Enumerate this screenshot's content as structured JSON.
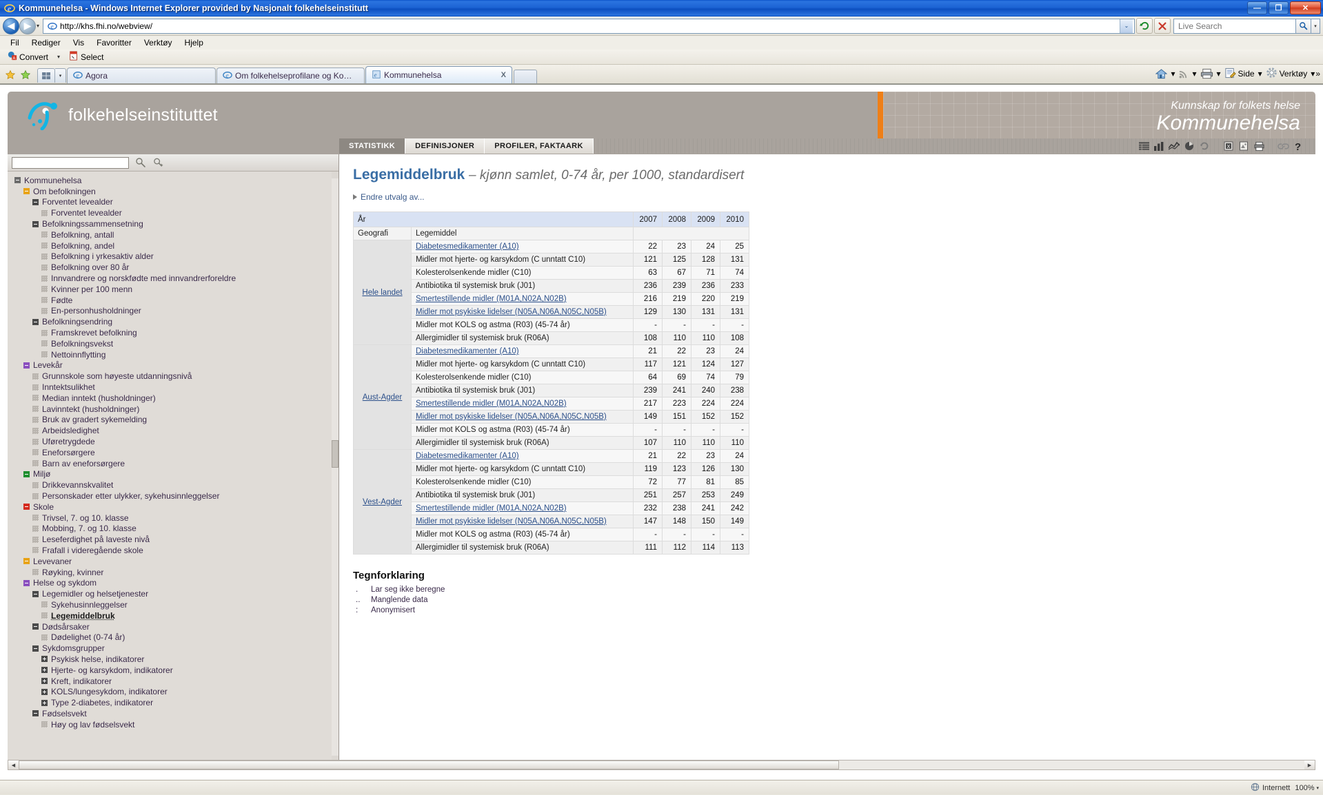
{
  "window": {
    "title": "Kommunehelsa - Windows Internet Explorer provided by Nasjonalt folkehelseinstitutt",
    "minimize": "—",
    "maximize": "❐",
    "close": "✕"
  },
  "address": {
    "url": "http://khs.fhi.no/webview/",
    "dropdown_caret": "⌄",
    "refresh_icon": "refresh-icon",
    "stop_icon": "stop-icon",
    "search_placeholder": "Live Search"
  },
  "menu": {
    "items": [
      "Fil",
      "Rediger",
      "Vis",
      "Favoritter",
      "Verktøy",
      "Hjelp"
    ]
  },
  "acrobat_toolbar": {
    "convert_label": "Convert",
    "select_label": "Select",
    "dropdown_caret": "▾"
  },
  "tabs": {
    "items": [
      {
        "label": "Agora",
        "active": false
      },
      {
        "label": "Om folkehelseprofilane og Ko…",
        "active": false
      },
      {
        "label": "Kommunehelsa",
        "active": true,
        "close": "X"
      }
    ]
  },
  "browser_tools": {
    "home": "Hjem",
    "feeds": "Feeds",
    "print": "Skriv ut",
    "page_label": "Side",
    "tools_label": "Verktøy",
    "overflow": "»",
    "caret": "▾"
  },
  "site_header": {
    "logo_text": "folkehelseinstituttet",
    "tagline": "Kunnskap for folkets helse",
    "site_name": "Kommunehelsa",
    "accent_color": "#ee7f18",
    "header_bg": "#a9a39d"
  },
  "nav": {
    "tabs": [
      {
        "label": "STATISTIKK",
        "active": true
      },
      {
        "label": "DEFINISJONER",
        "active": false
      },
      {
        "label": "PROFILER, FAKTAARK",
        "active": false
      }
    ],
    "icons": [
      "table-view-icon",
      "bar-chart-icon",
      "line-chart-icon",
      "pie-chart-icon",
      "refresh-icon",
      "excel-export-icon",
      "pdf-export-icon",
      "print-icon",
      "link-icon",
      "help-icon"
    ]
  },
  "sidebar": {
    "search_value": "",
    "search_icon": "search-icon",
    "search_advanced_icon": "advanced-search-icon",
    "tree": [
      {
        "label": "Kommunehelsa",
        "level": 0,
        "type": "box",
        "color": "#6b6b6b"
      },
      {
        "label": "Om befolkningen",
        "level": 1,
        "type": "box",
        "color": "#e8a317"
      },
      {
        "label": "Forventet levealder",
        "level": 2,
        "type": "box",
        "color": "#4a4a4a"
      },
      {
        "label": "Forventet levealder",
        "level": 3,
        "type": "leaf"
      },
      {
        "label": "Befolkningssammensetning",
        "level": 2,
        "type": "box",
        "color": "#4a4a4a"
      },
      {
        "label": "Befolkning, antall",
        "level": 3,
        "type": "leaf"
      },
      {
        "label": "Befolkning, andel",
        "level": 3,
        "type": "leaf"
      },
      {
        "label": "Befolkning i yrkesaktiv alder",
        "level": 3,
        "type": "leaf"
      },
      {
        "label": "Befolkning over 80 år",
        "level": 3,
        "type": "leaf"
      },
      {
        "label": "Innvandrere og norskfødte med innvandrerforeldre",
        "level": 3,
        "type": "leaf"
      },
      {
        "label": "Kvinner per 100 menn",
        "level": 3,
        "type": "leaf"
      },
      {
        "label": "Fødte",
        "level": 3,
        "type": "leaf"
      },
      {
        "label": "En-personhusholdninger",
        "level": 3,
        "type": "leaf"
      },
      {
        "label": "Befolkningsendring",
        "level": 2,
        "type": "box",
        "color": "#4a4a4a"
      },
      {
        "label": "Framskrevet befolkning",
        "level": 3,
        "type": "leaf"
      },
      {
        "label": "Befolkningsvekst",
        "level": 3,
        "type": "leaf"
      },
      {
        "label": "Nettoinnflytting",
        "level": 3,
        "type": "leaf"
      },
      {
        "label": "Levekår",
        "level": 1,
        "type": "box",
        "color": "#8a4fbe"
      },
      {
        "label": "Grunnskole som høyeste utdanningsnivå",
        "level": 2,
        "type": "leaf"
      },
      {
        "label": "Inntektsulikhet",
        "level": 2,
        "type": "leaf"
      },
      {
        "label": "Median inntekt (husholdninger)",
        "level": 2,
        "type": "leaf"
      },
      {
        "label": "Lavinntekt (husholdninger)",
        "level": 2,
        "type": "leaf"
      },
      {
        "label": "Bruk av gradert sykemelding",
        "level": 2,
        "type": "leaf"
      },
      {
        "label": "Arbeidsledighet",
        "level": 2,
        "type": "leaf"
      },
      {
        "label": "Uføretrygdede",
        "level": 2,
        "type": "leaf"
      },
      {
        "label": "Eneforsørgere",
        "level": 2,
        "type": "leaf"
      },
      {
        "label": "Barn av eneforsørgere",
        "level": 2,
        "type": "leaf"
      },
      {
        "label": "Miljø",
        "level": 1,
        "type": "box",
        "color": "#1e8e2e"
      },
      {
        "label": "Drikkevannskvalitet",
        "level": 2,
        "type": "leaf"
      },
      {
        "label": "Personskader etter ulykker, sykehusinnleggelser",
        "level": 2,
        "type": "leaf"
      },
      {
        "label": "Skole",
        "level": 1,
        "type": "box",
        "color": "#d42a1e"
      },
      {
        "label": "Trivsel, 7. og 10. klasse",
        "level": 2,
        "type": "leaf"
      },
      {
        "label": "Mobbing, 7. og 10. klasse",
        "level": 2,
        "type": "leaf"
      },
      {
        "label": "Leseferdighet på laveste nivå",
        "level": 2,
        "type": "leaf"
      },
      {
        "label": "Frafall i videregående skole",
        "level": 2,
        "type": "leaf"
      },
      {
        "label": "Levevaner",
        "level": 1,
        "type": "box",
        "color": "#e8a317"
      },
      {
        "label": "Røyking, kvinner",
        "level": 2,
        "type": "leaf"
      },
      {
        "label": "Helse og sykdom",
        "level": 1,
        "type": "box",
        "color": "#8a4fbe"
      },
      {
        "label": "Legemidler og helsetjenester",
        "level": 2,
        "type": "box",
        "color": "#4a4a4a"
      },
      {
        "label": "Sykehusinnleggelser",
        "level": 3,
        "type": "leaf"
      },
      {
        "label": "Legemiddelbruk",
        "level": 3,
        "type": "leaf",
        "selected": true
      },
      {
        "label": "Dødsårsaker",
        "level": 2,
        "type": "box",
        "color": "#4a4a4a"
      },
      {
        "label": "Dødelighet (0-74 år)",
        "level": 3,
        "type": "leaf"
      },
      {
        "label": "Sykdomsgrupper",
        "level": 2,
        "type": "box",
        "color": "#4a4a4a"
      },
      {
        "label": "Psykisk helse, indikatorer",
        "level": 3,
        "type": "box",
        "plus": true,
        "color": "#4a4a4a"
      },
      {
        "label": "Hjerte- og karsykdom, indikatorer",
        "level": 3,
        "type": "box",
        "plus": true,
        "color": "#4a4a4a"
      },
      {
        "label": "Kreft, indikatorer",
        "level": 3,
        "type": "box",
        "plus": true,
        "color": "#4a4a4a"
      },
      {
        "label": "KOLS/lungesykdom, indikatorer",
        "level": 3,
        "type": "box",
        "plus": true,
        "color": "#4a4a4a"
      },
      {
        "label": "Type 2-diabetes, indikatorer",
        "level": 3,
        "type": "box",
        "plus": true,
        "color": "#4a4a4a"
      },
      {
        "label": "Fødselsvekt",
        "level": 2,
        "type": "box",
        "color": "#4a4a4a"
      },
      {
        "label": "Høy og lav fødselsvekt",
        "level": 3,
        "type": "leaf"
      }
    ]
  },
  "content": {
    "title": "Legemiddelbruk",
    "subtitle": "– kjønn samlet, 0-74 år, per 1000, standardisert",
    "change_selection": "Endre utvalg av...",
    "table": {
      "year_header": "År",
      "geo_header": "Geografi",
      "drug_header": "Legemiddel",
      "years": [
        "2007",
        "2008",
        "2009",
        "2010"
      ],
      "groups": [
        {
          "geography": "Hele landet",
          "rows": [
            {
              "drug": "Diabetesmedikamenter (A10)",
              "link": true,
              "values": [
                "22",
                "23",
                "24",
                "25"
              ]
            },
            {
              "drug": "Midler mot hjerte- og karsykdom (C unntatt C10)",
              "link": false,
              "values": [
                "121",
                "125",
                "128",
                "131"
              ]
            },
            {
              "drug": "Kolesterolsenkende midler (C10)",
              "link": false,
              "values": [
                "63",
                "67",
                "71",
                "74"
              ]
            },
            {
              "drug": "Antibiotika til systemisk bruk (J01)",
              "link": false,
              "values": [
                "236",
                "239",
                "236",
                "233"
              ]
            },
            {
              "drug": "Smertestillende midler (M01A,N02A,N02B)",
              "link": true,
              "values": [
                "216",
                "219",
                "220",
                "219"
              ]
            },
            {
              "drug": "Midler mot psykiske lidelser (N05A,N06A,N05C,N05B)",
              "link": true,
              "values": [
                "129",
                "130",
                "131",
                "131"
              ]
            },
            {
              "drug": "Midler mot KOLS og astma (R03) (45-74 år)",
              "link": false,
              "values": [
                "-",
                "-",
                "-",
                "-"
              ]
            },
            {
              "drug": "Allergimidler til systemisk bruk (R06A)",
              "link": false,
              "values": [
                "108",
                "110",
                "110",
                "108"
              ]
            }
          ]
        },
        {
          "geography": "Aust-Agder",
          "rows": [
            {
              "drug": "Diabetesmedikamenter (A10)",
              "link": true,
              "values": [
                "21",
                "22",
                "23",
                "24"
              ]
            },
            {
              "drug": "Midler mot hjerte- og karsykdom (C unntatt C10)",
              "link": false,
              "values": [
                "117",
                "121",
                "124",
                "127"
              ]
            },
            {
              "drug": "Kolesterolsenkende midler (C10)",
              "link": false,
              "values": [
                "64",
                "69",
                "74",
                "79"
              ]
            },
            {
              "drug": "Antibiotika til systemisk bruk (J01)",
              "link": false,
              "values": [
                "239",
                "241",
                "240",
                "238"
              ]
            },
            {
              "drug": "Smertestillende midler (M01A,N02A,N02B)",
              "link": true,
              "values": [
                "217",
                "223",
                "224",
                "224"
              ]
            },
            {
              "drug": "Midler mot psykiske lidelser (N05A,N06A,N05C,N05B)",
              "link": true,
              "values": [
                "149",
                "151",
                "152",
                "152"
              ]
            },
            {
              "drug": "Midler mot KOLS og astma (R03) (45-74 år)",
              "link": false,
              "values": [
                "-",
                "-",
                "-",
                "-"
              ]
            },
            {
              "drug": "Allergimidler til systemisk bruk (R06A)",
              "link": false,
              "values": [
                "107",
                "110",
                "110",
                "110"
              ]
            }
          ]
        },
        {
          "geography": "Vest-Agder",
          "rows": [
            {
              "drug": "Diabetesmedikamenter (A10)",
              "link": true,
              "values": [
                "21",
                "22",
                "23",
                "24"
              ]
            },
            {
              "drug": "Midler mot hjerte- og karsykdom (C unntatt C10)",
              "link": false,
              "values": [
                "119",
                "123",
                "126",
                "130"
              ]
            },
            {
              "drug": "Kolesterolsenkende midler (C10)",
              "link": false,
              "values": [
                "72",
                "77",
                "81",
                "85"
              ]
            },
            {
              "drug": "Antibiotika til systemisk bruk (J01)",
              "link": false,
              "values": [
                "251",
                "257",
                "253",
                "249"
              ]
            },
            {
              "drug": "Smertestillende midler (M01A,N02A,N02B)",
              "link": true,
              "values": [
                "232",
                "238",
                "241",
                "242"
              ]
            },
            {
              "drug": "Midler mot psykiske lidelser (N05A,N06A,N05C,N05B)",
              "link": true,
              "values": [
                "147",
                "148",
                "150",
                "149"
              ]
            },
            {
              "drug": "Midler mot KOLS og astma (R03) (45-74 år)",
              "link": false,
              "values": [
                "-",
                "-",
                "-",
                "-"
              ]
            },
            {
              "drug": "Allergimidler til systemisk bruk (R06A)",
              "link": false,
              "values": [
                "111",
                "112",
                "114",
                "113"
              ]
            }
          ]
        }
      ]
    },
    "legend": {
      "title": "Tegnforklaring",
      "entries": [
        {
          "symbol": ".",
          "text": "Lar seg ikke beregne"
        },
        {
          "symbol": "..",
          "text": "Manglende data"
        },
        {
          "symbol": ":",
          "text": "Anonymisert"
        }
      ]
    }
  },
  "chart_data": {
    "type": "table",
    "title": "Legemiddelbruk – kjønn samlet, 0-74 år, per 1000, standardisert",
    "xlabel": "År",
    "ylabel": "Per 1000, standardisert",
    "categories": [
      "2007",
      "2008",
      "2009",
      "2010"
    ],
    "series": [
      {
        "name": "Hele landet – Diabetesmedikamenter (A10)",
        "values": [
          22,
          23,
          24,
          25
        ]
      },
      {
        "name": "Hele landet – Midler mot hjerte- og karsykdom (C unntatt C10)",
        "values": [
          121,
          125,
          128,
          131
        ]
      },
      {
        "name": "Hele landet – Kolesterolsenkende midler (C10)",
        "values": [
          63,
          67,
          71,
          74
        ]
      },
      {
        "name": "Hele landet – Antibiotika til systemisk bruk (J01)",
        "values": [
          236,
          239,
          236,
          233
        ]
      },
      {
        "name": "Hele landet – Smertestillende midler (M01A,N02A,N02B)",
        "values": [
          216,
          219,
          220,
          219
        ]
      },
      {
        "name": "Hele landet – Midler mot psykiske lidelser (N05A,N06A,N05C,N05B)",
        "values": [
          129,
          130,
          131,
          131
        ]
      },
      {
        "name": "Hele landet – Midler mot KOLS og astma (R03) (45-74 år)",
        "values": [
          null,
          null,
          null,
          null
        ]
      },
      {
        "name": "Hele landet – Allergimidler til systemisk bruk (R06A)",
        "values": [
          108,
          110,
          110,
          108
        ]
      },
      {
        "name": "Aust-Agder – Diabetesmedikamenter (A10)",
        "values": [
          21,
          22,
          23,
          24
        ]
      },
      {
        "name": "Aust-Agder – Midler mot hjerte- og karsykdom (C unntatt C10)",
        "values": [
          117,
          121,
          124,
          127
        ]
      },
      {
        "name": "Aust-Agder – Kolesterolsenkende midler (C10)",
        "values": [
          64,
          69,
          74,
          79
        ]
      },
      {
        "name": "Aust-Agder – Antibiotika til systemisk bruk (J01)",
        "values": [
          239,
          241,
          240,
          238
        ]
      },
      {
        "name": "Aust-Agder – Smertestillende midler (M01A,N02A,N02B)",
        "values": [
          217,
          223,
          224,
          224
        ]
      },
      {
        "name": "Aust-Agder – Midler mot psykiske lidelser (N05A,N06A,N05C,N05B)",
        "values": [
          149,
          151,
          152,
          152
        ]
      },
      {
        "name": "Aust-Agder – Midler mot KOLS og astma (R03) (45-74 år)",
        "values": [
          null,
          null,
          null,
          null
        ]
      },
      {
        "name": "Aust-Agder – Allergimidler til systemisk bruk (R06A)",
        "values": [
          107,
          110,
          110,
          110
        ]
      },
      {
        "name": "Vest-Agder – Diabetesmedikamenter (A10)",
        "values": [
          21,
          22,
          23,
          24
        ]
      },
      {
        "name": "Vest-Agder – Midler mot hjerte- og karsykdom (C unntatt C10)",
        "values": [
          119,
          123,
          126,
          130
        ]
      },
      {
        "name": "Vest-Agder – Kolesterolsenkende midler (C10)",
        "values": [
          72,
          77,
          81,
          85
        ]
      },
      {
        "name": "Vest-Agder – Antibiotika til systemisk bruk (J01)",
        "values": [
          251,
          257,
          253,
          249
        ]
      },
      {
        "name": "Vest-Agder – Smertestillende midler (M01A,N02A,N02B)",
        "values": [
          232,
          238,
          241,
          242
        ]
      },
      {
        "name": "Vest-Agder – Midler mot psykiske lidelser (N05A,N06A,N05C,N05B)",
        "values": [
          147,
          148,
          150,
          149
        ]
      },
      {
        "name": "Vest-Agder – Midler mot KOLS og astma (R03) (45-74 år)",
        "values": [
          null,
          null,
          null,
          null
        ]
      },
      {
        "name": "Vest-Agder – Allergimidler til systemisk bruk (R06A)",
        "values": [
          111,
          112,
          114,
          113
        ]
      }
    ]
  },
  "statusbar": {
    "text": "",
    "zone": "Internett",
    "zoom": "100%"
  }
}
